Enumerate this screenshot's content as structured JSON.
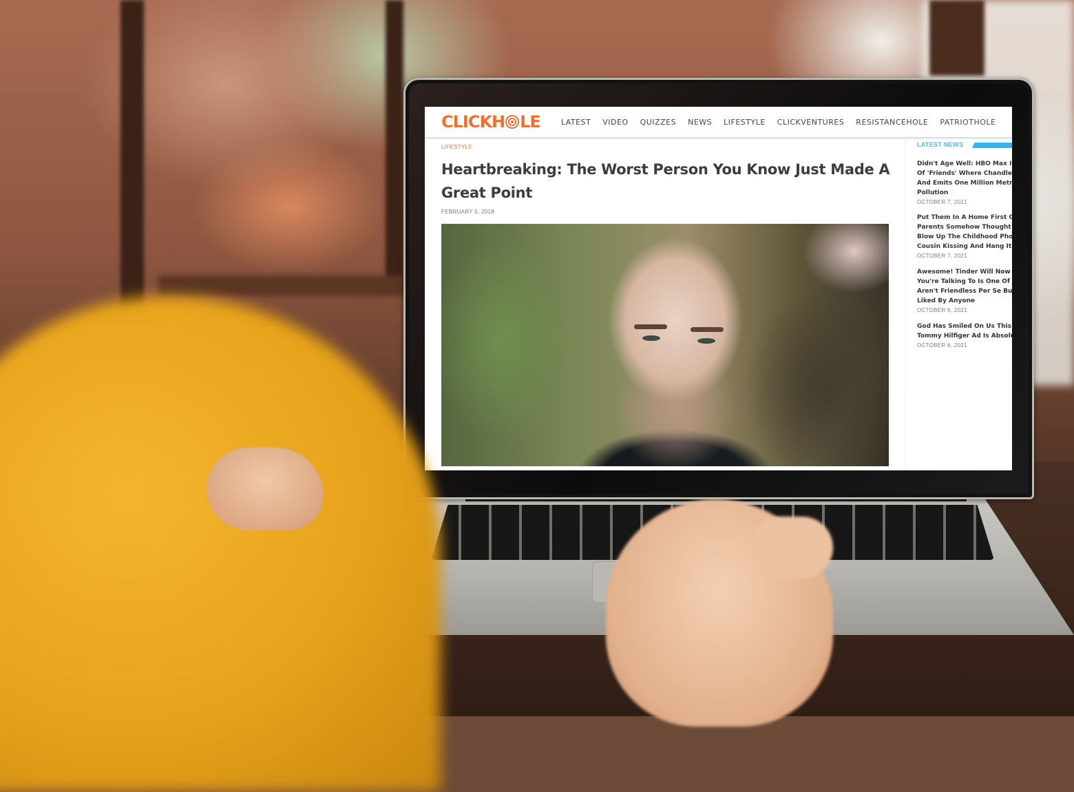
{
  "site": {
    "logo_text_left": "CLICKH",
    "logo_text_right": "LE",
    "brand_color": "#f0702e",
    "accent_color": "#2fb3e3",
    "nav_items": [
      {
        "label": "LATEST"
      },
      {
        "label": "VIDEO"
      },
      {
        "label": "QUIZZES"
      },
      {
        "label": "NEWS"
      },
      {
        "label": "LIFESTYLE"
      },
      {
        "label": "CLICKVENTURES"
      },
      {
        "label": "RESISTANCEHOLE"
      },
      {
        "label": "PATRIOTHOLE"
      }
    ]
  },
  "article": {
    "category": "LIFESTYLE",
    "headline_line1": "Heartbreaking: The Worst Person You Know Just Made A",
    "headline_line2": "Great Point",
    "date": "FEBRUARY 5, 2018",
    "image_description": "portrait of a bald man with stubble against blurred green background"
  },
  "sidebar": {
    "section_label": "LATEST NEWS",
    "items": [
      {
        "lines": [
          "Didn't Age Well: HBO Max Is Pu",
          "Of 'Friends' Where Chandler U",
          "And Emits One Million Metric T",
          "Pollution"
        ],
        "date": "OCTOBER 7, 2021"
      },
      {
        "lines": [
          "Put Them In A Home First Char",
          "Parents Somehow Thought It W",
          "Blow Up The Childhood Photo",
          "Cousin Kissing And Hang It Ab"
        ],
        "date": "OCTOBER 7, 2021"
      },
      {
        "lines": [
          "Awesome! Tinder Will Now Wa",
          "You're Talking To Is One Of Th",
          "Aren't Friendless Per Se But Ar",
          "Liked By Anyone"
        ],
        "date": "OCTOBER 6, 2021"
      },
      {
        "lines": [
          "God Has Smiled On Us This Da",
          "Tommy Hilfiger Ad Is Absolute"
        ],
        "date": "OCTOBER 6, 2021"
      }
    ]
  }
}
